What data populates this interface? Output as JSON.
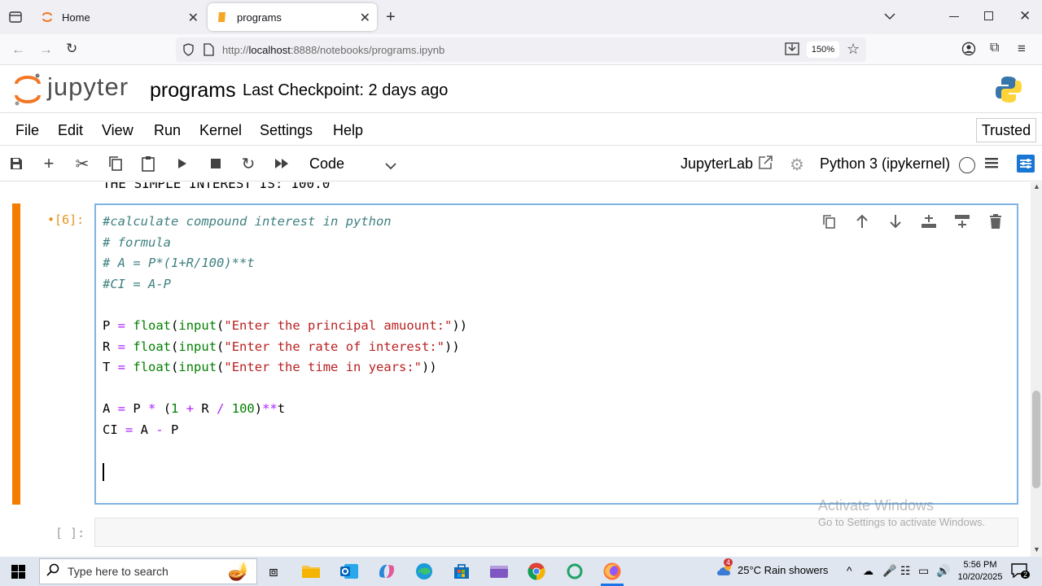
{
  "browser": {
    "tabs": [
      {
        "label": "Home",
        "active": false
      },
      {
        "label": "programs",
        "active": true
      }
    ],
    "url_prefix": "http://",
    "url_host": "localhost",
    "url_rest": ":8888/notebooks/programs.ipynb",
    "zoom": "150%"
  },
  "jupyter": {
    "logo_text": "jupyter",
    "notebook_title": "programs",
    "checkpoint": "Last Checkpoint: 2 days ago",
    "menu": [
      "File",
      "Edit",
      "View",
      "Run",
      "Kernel",
      "Settings",
      "Help"
    ],
    "trusted": "Trusted",
    "cell_type": "Code",
    "jupyterlab_link": "JupyterLab",
    "kernel": "Python 3 (ipykernel)"
  },
  "notebook": {
    "previous_output": "THE SIMPLE INTEREST IS: 100.0",
    "active_prompt": "•[6]:",
    "empty_prompt": "[ ]:",
    "code_lines": [
      "#calculate compound interest in python",
      "# formula",
      "# A = P*(1+R/100)**t",
      "#CI = A-P",
      "",
      "P = float(input(\"Enter the principal amuount:\"))",
      "R = float(input(\"Enter the rate of interest:\"))",
      "T = float(input(\"Enter the time in years:\"))",
      "",
      "A = P * (1 + R / 100)**t",
      "CI = A - P"
    ]
  },
  "watermark": {
    "line1": "Activate Windows",
    "line2": "Go to Settings to activate Windows."
  },
  "taskbar": {
    "search_placeholder": "Type here to search",
    "weather": "25°C  Rain showers",
    "weather_badge": "4",
    "time": "5:56 PM",
    "date": "10/20/2025",
    "notification_count": "2"
  },
  "colors": {
    "active_bar": "#f57c00",
    "editor_border": "#7fb3e4",
    "comment": "#408080",
    "builtin": "#008000",
    "string": "#ba2121",
    "operator": "#aa22ff"
  }
}
